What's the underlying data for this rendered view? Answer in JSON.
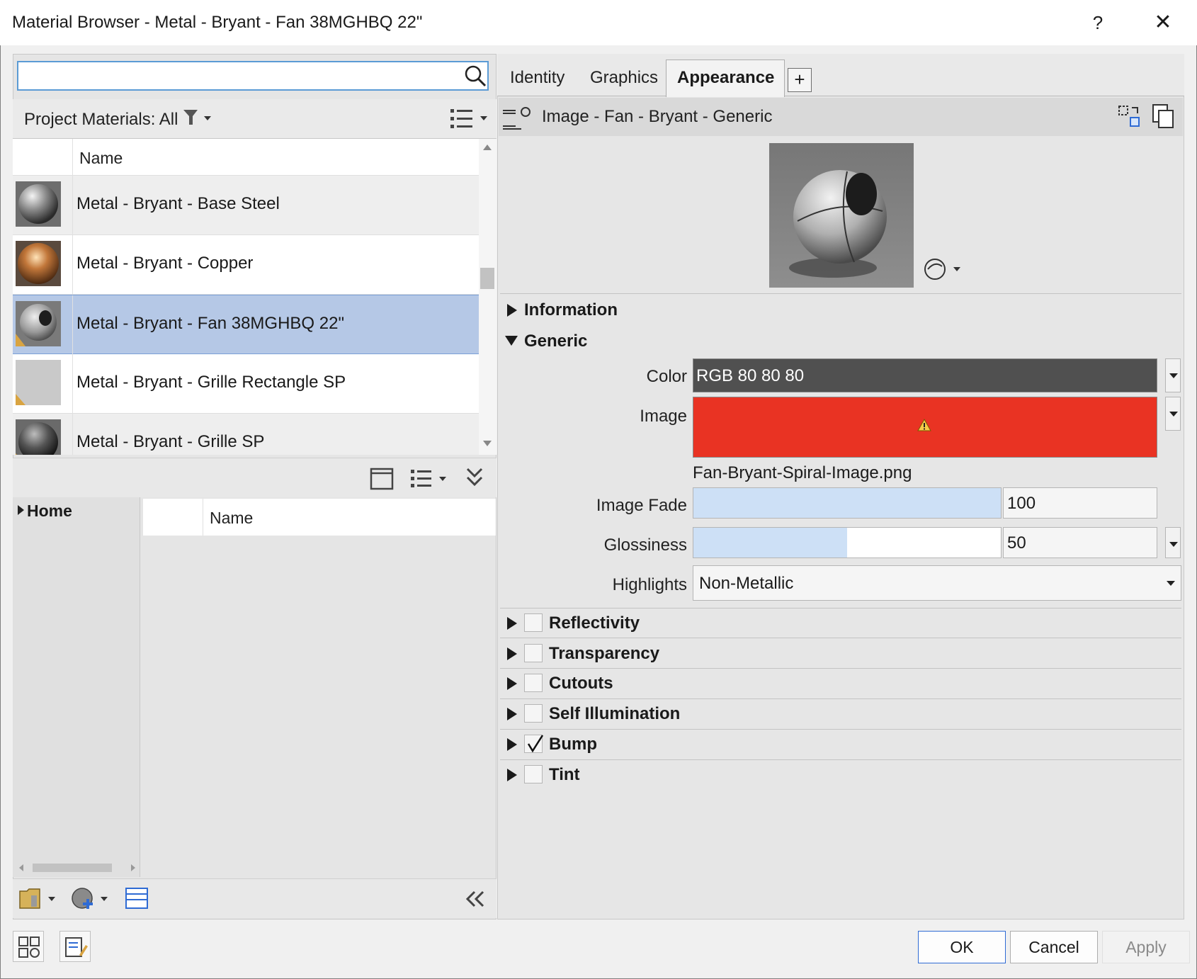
{
  "window": {
    "title": "Material Browser - Metal - Bryant - Fan 38MGHBQ 22\"",
    "help_label": "?",
    "close_label": "✕"
  },
  "search": {
    "value": "",
    "placeholder": ""
  },
  "project": {
    "label": "Project Materials: All"
  },
  "materials": {
    "header_name": "Name",
    "items": [
      {
        "label": "Metal - Bryant - Base Steel",
        "thumb": "chrome-sphere",
        "selected": false
      },
      {
        "label": "Metal - Bryant - Copper",
        "thumb": "copper-sphere",
        "selected": false
      },
      {
        "label": "Metal - Bryant - Fan 38MGHBQ 22\"",
        "thumb": "fan-sphere",
        "selected": true
      },
      {
        "label": "Metal - Bryant - Grille Rectangle SP",
        "thumb": "grey-square",
        "selected": false
      },
      {
        "label": "Metal - Bryant - Grille SP",
        "thumb": "dark-sphere",
        "selected": false
      }
    ]
  },
  "library": {
    "tree_home": "Home",
    "list_header_name": "Name"
  },
  "tabs": {
    "identity": "Identity",
    "graphics": "Graphics",
    "appearance": "Appearance",
    "add": "+"
  },
  "asset": {
    "label": "Image - Fan - Bryant - Generic"
  },
  "sections": {
    "information": "Information",
    "generic": "Generic",
    "reflectivity": "Reflectivity",
    "transparency": "Transparency",
    "cutouts": "Cutouts",
    "self_illumination": "Self Illumination",
    "bump": "Bump",
    "tint": "Tint"
  },
  "checks": {
    "reflectivity": false,
    "transparency": false,
    "cutouts": false,
    "self_illumination": false,
    "bump": true,
    "tint": false
  },
  "generic": {
    "color_label": "Color",
    "color_value": "RGB 80 80 80",
    "color_hex": "#505050",
    "image_label": "Image",
    "image_hex": "#e93323",
    "image_filename": "Fan-Bryant-Spiral-Image.png",
    "image_fade_label": "Image Fade",
    "image_fade_value": "100",
    "image_fade_fraction": 1.0,
    "glossiness_label": "Glossiness",
    "glossiness_value": "50",
    "glossiness_fraction": 0.5,
    "highlights_label": "Highlights",
    "highlights_value": "Non-Metallic"
  },
  "footer": {
    "ok": "OK",
    "cancel": "Cancel",
    "apply": "Apply"
  },
  "colors": {
    "selection": "#b5c8e6",
    "accent": "#2f6bd4",
    "slider_fill": "#cde0f6"
  }
}
